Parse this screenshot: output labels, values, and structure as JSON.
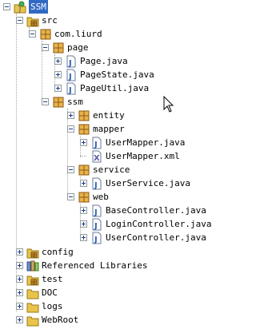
{
  "tree": {
    "project": "SSM",
    "src": "src",
    "package_root": "com.liurd",
    "page_pkg": "page",
    "page_files": [
      "Page.java",
      "PageState.java",
      "PageUtil.java"
    ],
    "ssm_pkg": "ssm",
    "entity_pkg": "entity",
    "mapper_pkg": "mapper",
    "mapper_files": [
      "UserMapper.java",
      "UserMapper.xml"
    ],
    "service_pkg": "service",
    "service_files": [
      "UserService.java"
    ],
    "web_pkg": "web",
    "web_files": [
      "BaseController.java",
      "LoginController.java",
      "UserController.java"
    ],
    "bottom": [
      "config",
      "Referenced Libraries",
      "test",
      "DOC",
      "logs",
      "WebRoot"
    ]
  },
  "icons": {
    "project": "project-icon",
    "source_folder": "source-folder-icon",
    "package": "package-icon",
    "java_file": "java-file-icon",
    "xml_file": "xml-file-icon",
    "library": "library-icon",
    "folder": "folder-icon"
  },
  "colors": {
    "selection": "#316ac5",
    "package": "#c58a2a",
    "java": "#2a62b8",
    "folder": "#e8c44a"
  }
}
